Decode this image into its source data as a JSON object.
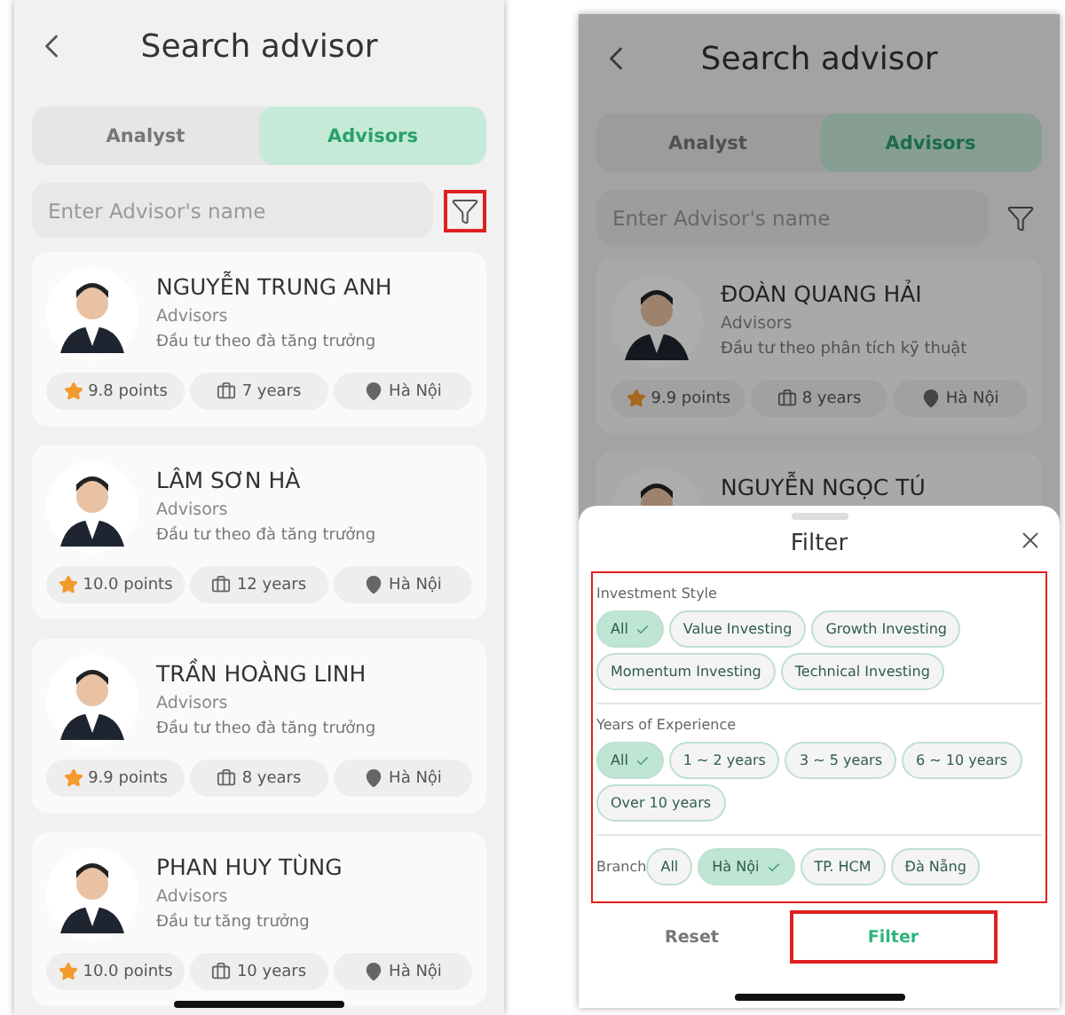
{
  "screens": [
    {
      "title": "Search advisor",
      "tabs": [
        {
          "label": "Analyst",
          "selected": false
        },
        {
          "label": "Advisors",
          "selected": true
        }
      ],
      "search": {
        "placeholder": "Enter Advisor's name"
      },
      "filter_button": {
        "highlighted": true
      },
      "advisors": [
        {
          "name": "NGUYỄN TRUNG ANH",
          "role": "Advisors",
          "style": "Đầu tư theo đà tăng trưởng",
          "points": "9.8 points",
          "years": "7 years",
          "branch": "Hà Nội"
        },
        {
          "name": "LÂM SƠN HÀ",
          "role": "Advisors",
          "style": "Đầu tư theo đà tăng trưởng",
          "points": "10.0 points",
          "years": "12 years",
          "branch": "Hà Nội"
        },
        {
          "name": "TRẦN HOÀNG LINH",
          "role": "Advisors",
          "style": "Đầu tư theo đà tăng trưởng",
          "points": "9.9 points",
          "years": "8 years",
          "branch": "Hà Nội"
        },
        {
          "name": "PHAN HUY TÙNG",
          "role": "Advisors",
          "style": "Đầu tư tăng trưởng",
          "points": "10.0 points",
          "years": "10 years",
          "branch": "Hà Nội"
        }
      ]
    },
    {
      "title": "Search advisor",
      "tabs": [
        {
          "label": "Analyst",
          "selected": false
        },
        {
          "label": "Advisors",
          "selected": true
        }
      ],
      "search": {
        "placeholder": "Enter Advisor's name"
      },
      "filter_button": {
        "highlighted": false
      },
      "advisors": [
        {
          "name": "ĐOÀN QUANG HẢI",
          "role": "Advisors",
          "style": "Đầu tư theo phân tích kỹ thuật",
          "points": "9.9 points",
          "years": "8 years",
          "branch": "Hà Nội"
        },
        {
          "name": "NGUYỄN NGỌC TÚ"
        }
      ],
      "filter_sheet": {
        "title": "Filter",
        "highlighted": true,
        "sections": [
          {
            "kind": "stacked",
            "label": "Investment Style",
            "options": [
              {
                "label": "All",
                "selected": true
              },
              {
                "label": "Value Investing",
                "selected": false
              },
              {
                "label": "Growth Investing",
                "selected": false
              },
              {
                "label": "Momentum Investing",
                "selected": false
              },
              {
                "label": "Technical Investing",
                "selected": false
              }
            ]
          },
          {
            "kind": "stacked",
            "label": "Years of Experience",
            "options": [
              {
                "label": "All",
                "selected": true
              },
              {
                "label": "1 ~ 2 years",
                "selected": false
              },
              {
                "label": "3 ~ 5 years",
                "selected": false
              },
              {
                "label": "6 ~ 10 years",
                "selected": false
              },
              {
                "label": "Over 10 years",
                "selected": false
              }
            ]
          },
          {
            "kind": "inline",
            "label": "Branch",
            "options": [
              {
                "label": "All",
                "selected": false
              },
              {
                "label": "Hà Nội",
                "selected": true
              },
              {
                "label": "TP. HCM",
                "selected": false
              },
              {
                "label": "Đà Nẵng",
                "selected": false
              }
            ]
          }
        ],
        "reset": {
          "label": "Reset"
        },
        "apply": {
          "label": "Filter",
          "highlighted": true
        }
      }
    }
  ]
}
